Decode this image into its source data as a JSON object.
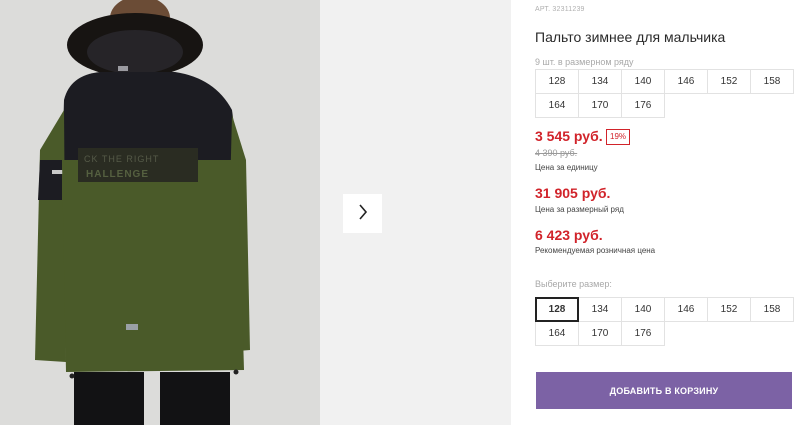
{
  "product": {
    "sku": "АРТ. 32311239",
    "title": "Пальто зимнее для мальчика",
    "photo_alt": "Пальто зимнее для мальчика — вид сзади"
  },
  "size_row": {
    "caption": "9 шт. в размерном ряду",
    "sizes": [
      "128",
      "134",
      "140",
      "146",
      "152",
      "158",
      "164",
      "170",
      "176"
    ]
  },
  "prices": {
    "unit_price": "3 545 руб.",
    "discount_badge": "19%",
    "old_price": "4 390 руб.",
    "unit_note": "Цена за единицу",
    "row_price": "31 905 руб.",
    "row_note": "Цена за размерный ряд",
    "rrp_price": "6 423 руб.",
    "rrp_note": "Рекомендуемая розничная цена"
  },
  "size_select": {
    "caption": "Выберите размер:",
    "sizes": [
      "128",
      "134",
      "140",
      "146",
      "152",
      "158",
      "164",
      "170",
      "176"
    ],
    "selected": "128"
  },
  "actions": {
    "add_to_cart": "ДОБАВИТЬ В КОРЗИНУ",
    "next_icon": "chevron-right-icon"
  },
  "colors": {
    "accent_button": "#7c62a5",
    "price_red": "#d1232a",
    "coat_green": "#4a5a29",
    "coat_dark": "#1c1c22"
  }
}
